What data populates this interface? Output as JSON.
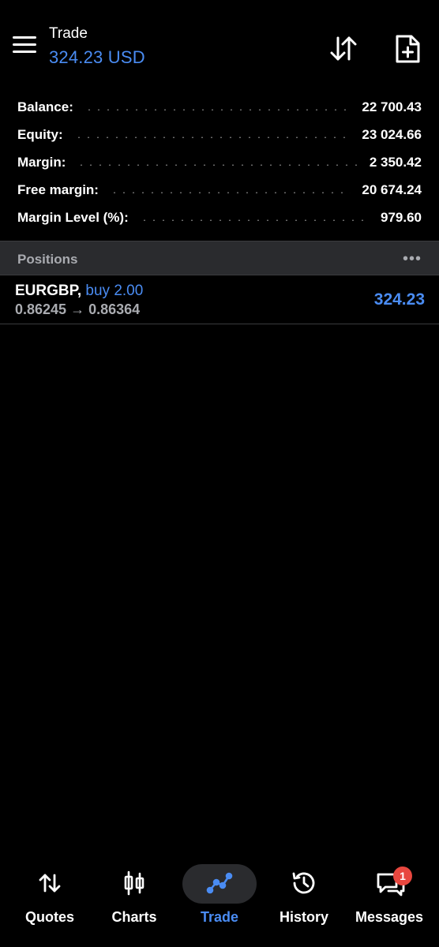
{
  "header": {
    "title": "Trade",
    "subtitle": "324.23 USD",
    "menu_icon": "hamburger-menu-icon",
    "sort_icon": "sort-arrows-icon",
    "new_order_icon": "new-document-icon"
  },
  "summary": [
    {
      "label": "Balance:",
      "value": "22 700.43"
    },
    {
      "label": "Equity:",
      "value": "23 024.66"
    },
    {
      "label": "Margin:",
      "value": "2 350.42"
    },
    {
      "label": "Free margin:",
      "value": "20 674.24"
    },
    {
      "label": "Margin Level (%):",
      "value": "979.60"
    }
  ],
  "positions": {
    "title": "Positions",
    "more_label": "•••",
    "items": [
      {
        "symbol": "EURGBP,",
        "side": "buy 2.00",
        "prices": "0.86245 → 0.86364",
        "profit": "324.23"
      }
    ]
  },
  "nav": {
    "items": [
      {
        "label": "Quotes",
        "icon": "quotes-arrows-icon"
      },
      {
        "label": "Charts",
        "icon": "candlestick-chart-icon"
      },
      {
        "label": "Trade",
        "icon": "trade-line-icon",
        "active": true
      },
      {
        "label": "History",
        "icon": "history-clock-icon"
      },
      {
        "label": "Messages",
        "icon": "messages-chat-icon",
        "badge": "1"
      }
    ]
  },
  "colors": {
    "accent": "#4a8cf3",
    "background": "#000000",
    "panel": "#2a2b2e",
    "muted_text": "#a9abb0",
    "badge": "#e8473f"
  }
}
